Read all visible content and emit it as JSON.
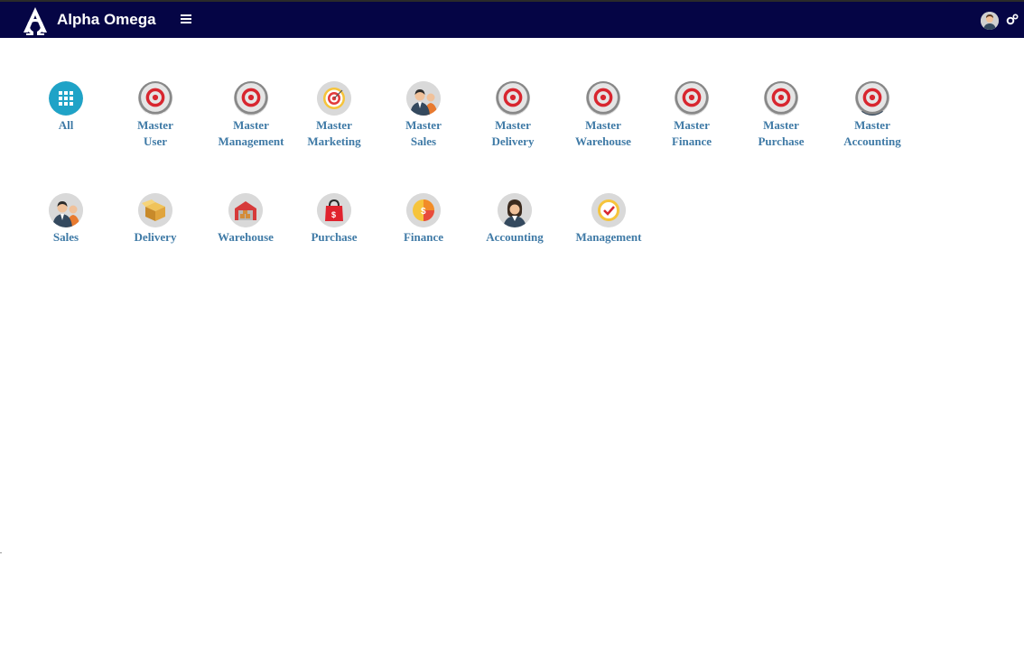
{
  "header": {
    "brand": "Alpha Omega",
    "colors": {
      "bar": "#050545",
      "label": "#3f7aa6",
      "all_icon": "#1fa3c7"
    }
  },
  "row1": [
    {
      "line1": "All",
      "line2": "",
      "icon": "grid-icon"
    },
    {
      "line1": "Master",
      "line2": "User",
      "icon": "user-icon"
    },
    {
      "line1": "Master",
      "line2": "Management",
      "icon": "check-badge-icon"
    },
    {
      "line1": "Master",
      "line2": "Marketing",
      "icon": "target-icon"
    },
    {
      "line1": "Master",
      "line2": "Sales",
      "icon": "team-icon"
    },
    {
      "line1": "Master",
      "line2": "Delivery",
      "icon": "box-icon"
    },
    {
      "line1": "Master",
      "line2": "Warehouse",
      "icon": "warehouse-icon"
    },
    {
      "line1": "Master",
      "line2": "Finance",
      "icon": "finance-icon"
    },
    {
      "line1": "Master",
      "line2": "Purchase",
      "icon": "shopping-bag-icon"
    },
    {
      "line1": "Master",
      "line2": "Accounting",
      "icon": "accountant-icon"
    }
  ],
  "row2": [
    {
      "line1": "Sales",
      "icon": "team-icon"
    },
    {
      "line1": "Delivery",
      "icon": "box-icon"
    },
    {
      "line1": "Warehouse",
      "icon": "warehouse-icon"
    },
    {
      "line1": "Purchase",
      "icon": "shopping-bag-icon"
    },
    {
      "line1": "Finance",
      "icon": "finance-icon"
    },
    {
      "line1": "Accounting",
      "icon": "accountant-icon"
    },
    {
      "line1": "Management",
      "icon": "check-badge-icon"
    }
  ]
}
